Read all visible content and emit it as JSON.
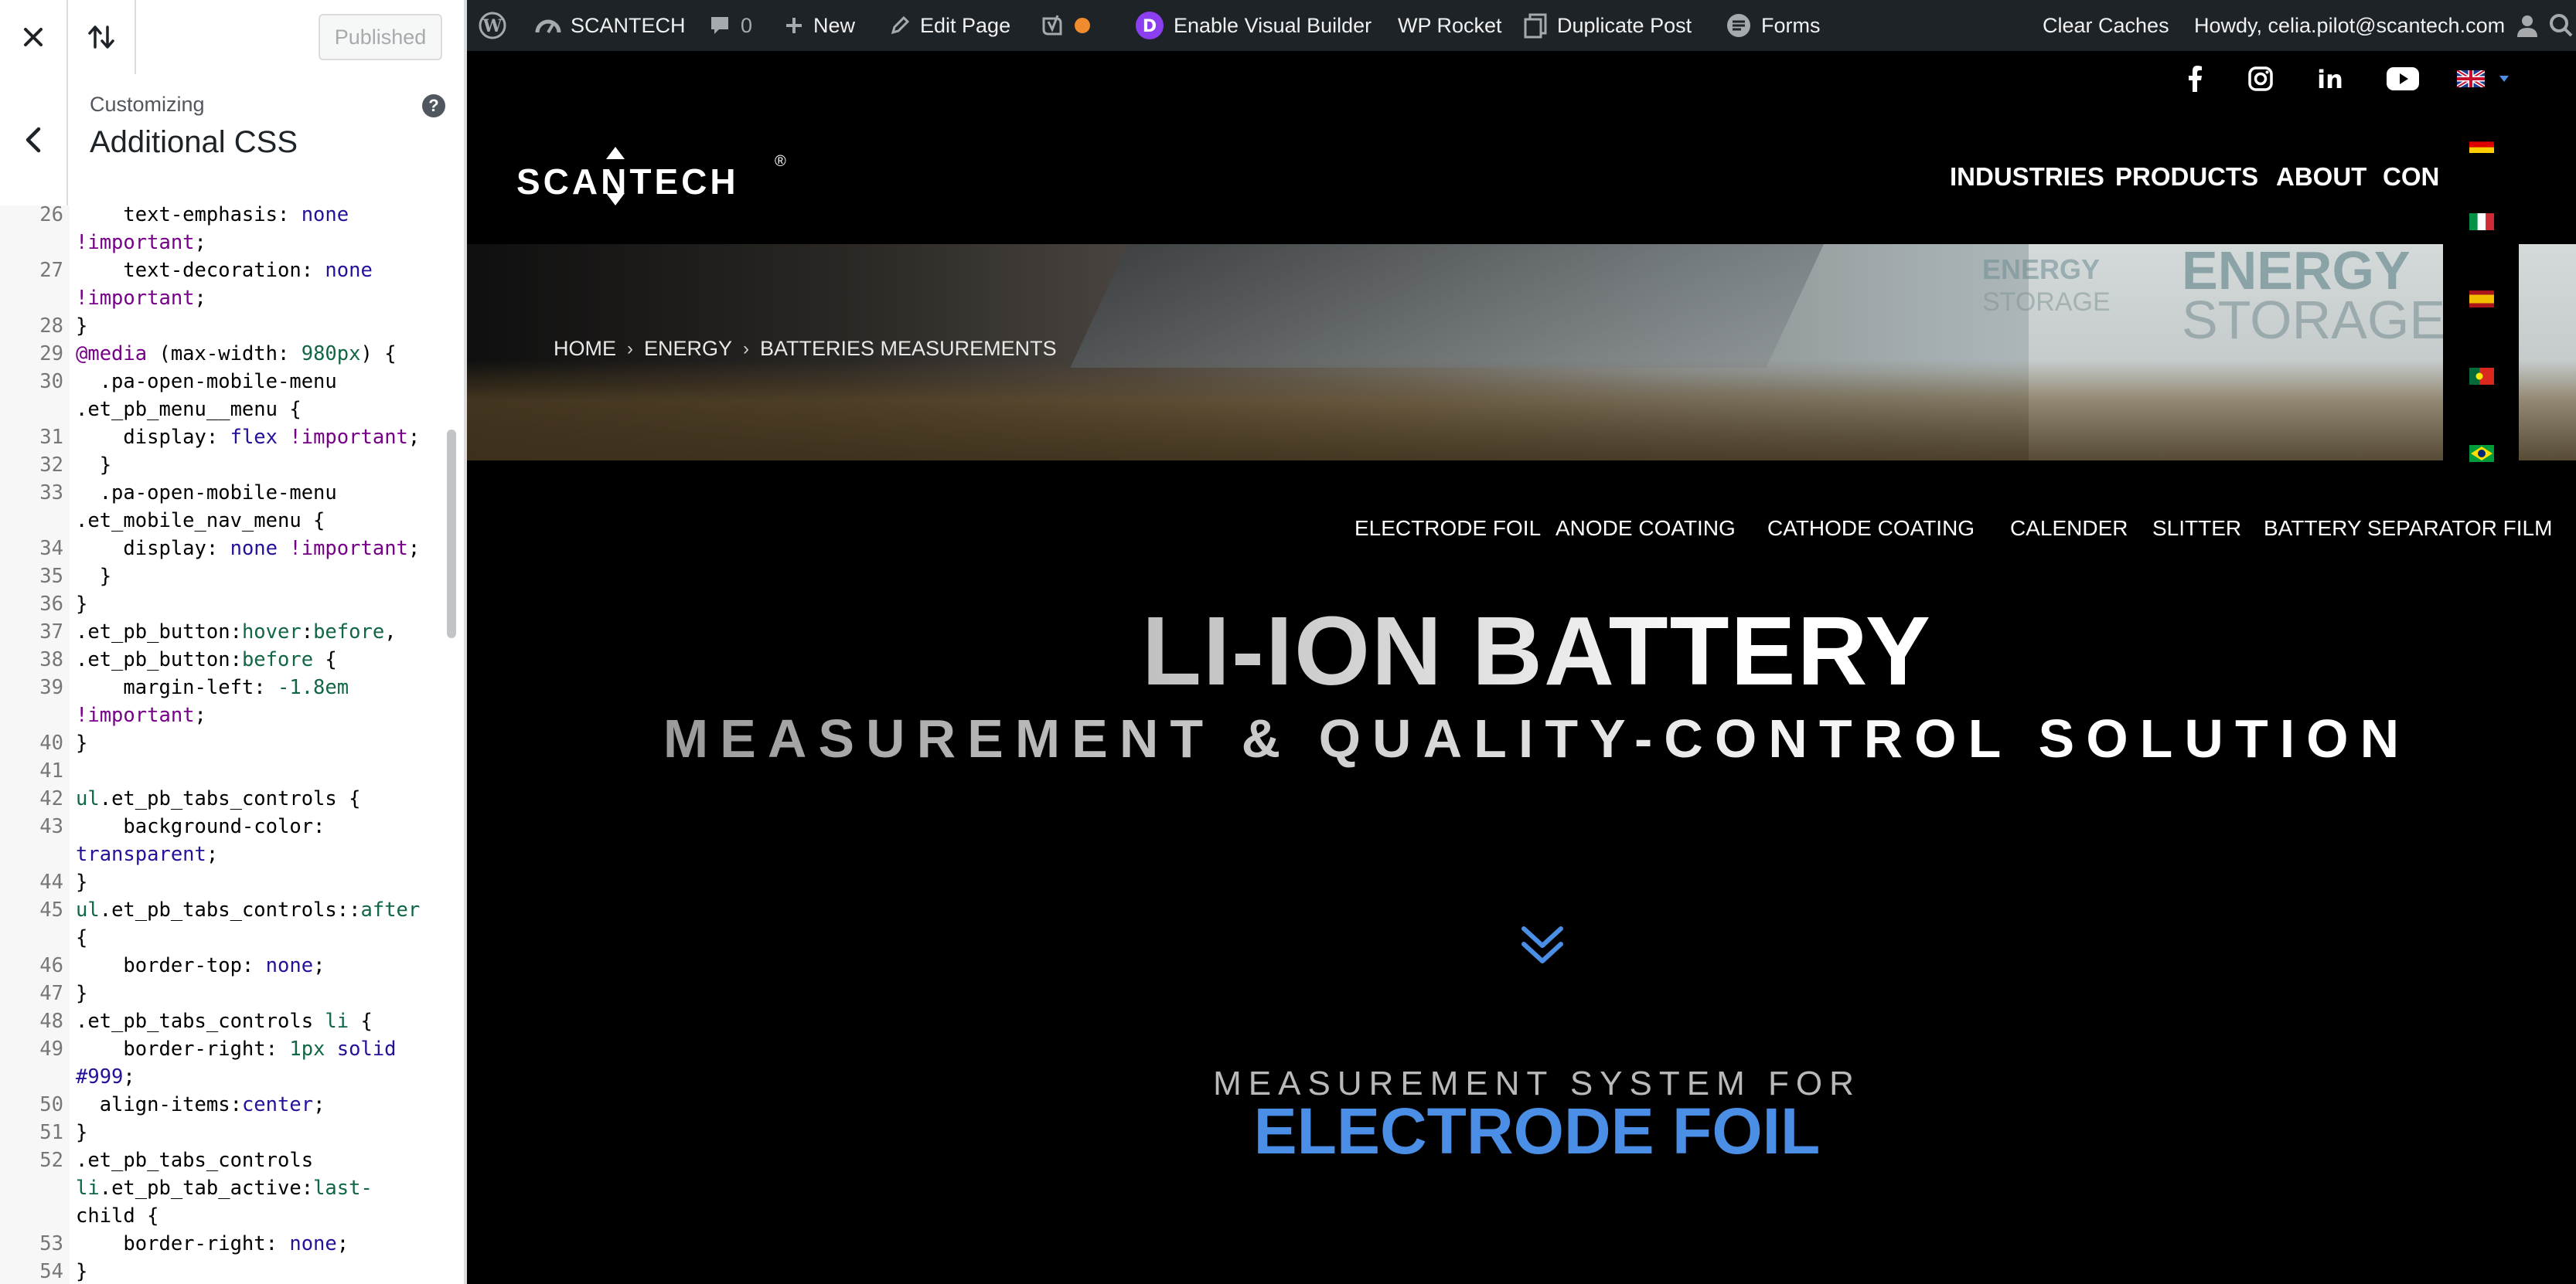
{
  "customizer": {
    "publish_label": "Published",
    "breadcrumb_small": "Customizing",
    "section_title": "Additional CSS",
    "help_label": "?"
  },
  "css_lines": [
    {
      "n": "26",
      "t": "    text-emphasis: none"
    },
    {
      "n": "",
      "t": "!important;"
    },
    {
      "n": "27",
      "t": "    text-decoration: none"
    },
    {
      "n": "",
      "t": "!important;"
    },
    {
      "n": "28",
      "t": "}"
    },
    {
      "n": "29",
      "t": "@media (max-width: 980px) {"
    },
    {
      "n": "30",
      "t": "  .pa-open-mobile-menu"
    },
    {
      "n": "",
      "t": ".et_pb_menu__menu {"
    },
    {
      "n": "31",
      "t": "    display: flex !important;"
    },
    {
      "n": "32",
      "t": "  }"
    },
    {
      "n": "33",
      "t": "  .pa-open-mobile-menu"
    },
    {
      "n": "",
      "t": ".et_mobile_nav_menu {"
    },
    {
      "n": "34",
      "t": "    display: none !important;"
    },
    {
      "n": "35",
      "t": "  }"
    },
    {
      "n": "36",
      "t": "}"
    },
    {
      "n": "37",
      "t": ".et_pb_button:hover:before,"
    },
    {
      "n": "38",
      "t": ".et_pb_button:before {"
    },
    {
      "n": "39",
      "t": "    margin-left: -1.8em"
    },
    {
      "n": "",
      "t": "!important;"
    },
    {
      "n": "40",
      "t": "}"
    },
    {
      "n": "41",
      "t": ""
    },
    {
      "n": "42",
      "t": "ul.et_pb_tabs_controls {"
    },
    {
      "n": "43",
      "t": "    background-color:"
    },
    {
      "n": "",
      "t": "transparent;"
    },
    {
      "n": "44",
      "t": "}"
    },
    {
      "n": "45",
      "t": "ul.et_pb_tabs_controls::after"
    },
    {
      "n": "",
      "t": "{"
    },
    {
      "n": "46",
      "t": "    border-top: none;"
    },
    {
      "n": "47",
      "t": "}"
    },
    {
      "n": "48",
      "t": ".et_pb_tabs_controls li {"
    },
    {
      "n": "49",
      "t": "    border-right: 1px solid"
    },
    {
      "n": "",
      "t": "#999;"
    },
    {
      "n": "50",
      "t": "  align-items:center;"
    },
    {
      "n": "51",
      "t": "}"
    },
    {
      "n": "52",
      "t": ".et_pb_tabs_controls"
    },
    {
      "n": "",
      "t": "li.et_pb_tab_active:last-"
    },
    {
      "n": "",
      "t": "child {"
    },
    {
      "n": "53",
      "t": "    border-right: none;"
    },
    {
      "n": "54",
      "t": "}"
    }
  ],
  "adminbar": {
    "site_name": "SCANTECH",
    "comments_count": "0",
    "new_label": "New",
    "edit_label": "Edit Page",
    "visual_builder": "Enable Visual Builder",
    "wp_rocket": "WP Rocket",
    "duplicate_post": "Duplicate Post",
    "forms": "Forms",
    "clear_caches": "Clear Caches",
    "howdy": "Howdy, celia.pilot@scantech.com"
  },
  "site": {
    "logo": "SCANTECH",
    "logo_mark": "®",
    "nav": [
      "INDUSTRIES",
      "PRODUCTS",
      "ABOUT",
      "CON"
    ],
    "breadcrumb": [
      "HOME",
      "ENERGY",
      "BATTERIES MEASUREMENTS"
    ],
    "breadcrumb_sep": "›",
    "hero_words": {
      "energy": "ENERGY",
      "storage": "STORAGE"
    },
    "subnav": [
      "ELECTRODE FOIL",
      "ANODE COATING",
      "CATHODE COATING",
      "CALENDER",
      "SLITTER",
      "BATTERY SEPARATOR FILM"
    ],
    "title": "LI-ION BATTERY",
    "subtitle": "MEASUREMENT & QUALITY-CONTROL SOLUTION",
    "section_kicker": "MEASUREMENT SYSTEM FOR",
    "section_title": "ELECTRODE FOIL"
  },
  "social_icons": [
    "facebook-icon",
    "instagram-icon",
    "linkedin-icon",
    "youtube-icon",
    "uk-flag-icon"
  ],
  "language_flags": [
    "germany-flag",
    "italy-flag",
    "spain-flag",
    "portugal-flag",
    "brazil-flag"
  ],
  "colors": {
    "admin_bar": "#1d2327",
    "accent_blue": "#4a8ee6",
    "divi_purple": "#8c3ff0",
    "status_orange": "#f08b2e"
  }
}
